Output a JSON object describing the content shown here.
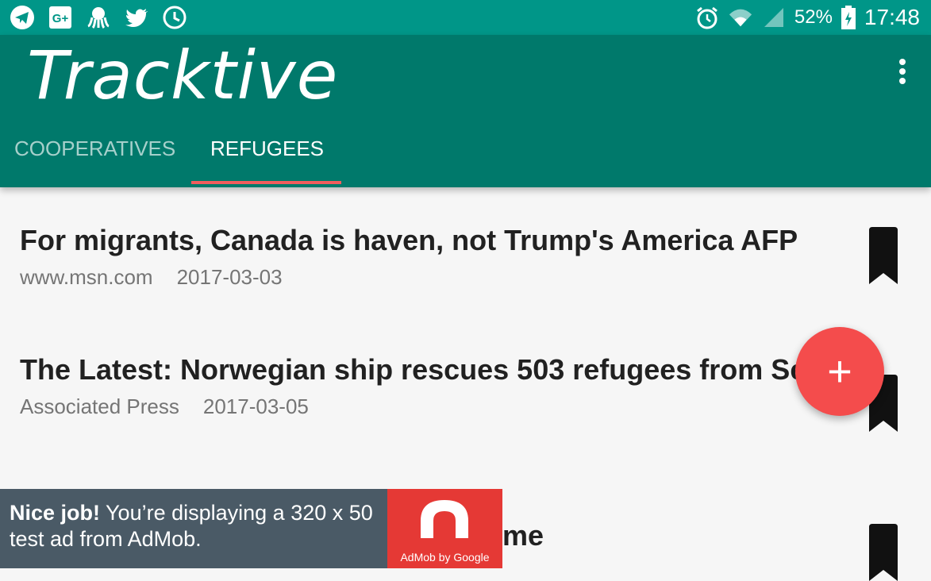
{
  "status_bar": {
    "battery": "52%",
    "time": "17:48",
    "left_icons": [
      "telegram-icon",
      "google-plus-icon",
      "octopus-icon",
      "twitter-icon",
      "clock-icon"
    ],
    "right_icons": [
      "alarm-icon",
      "wifi-icon",
      "signal-icon",
      "battery-icon"
    ]
  },
  "app_bar": {
    "title": "Tracktive",
    "tabs": [
      {
        "label": "COOPERATIVES",
        "active": false
      },
      {
        "label": "REFUGEES",
        "active": true
      }
    ]
  },
  "articles": [
    {
      "title": "For migrants, Canada is haven, not Trump's America AFP",
      "source": "www.msn.com",
      "date": "2017-03-03"
    },
    {
      "title": "The Latest: Norwegian ship rescues 503 refugees from Sea",
      "source": "Associated Press",
      "date": "2017-03-05"
    },
    {
      "title": "me"
    }
  ],
  "fab": {
    "label": "+"
  },
  "ad": {
    "strong": "Nice job!",
    "text": "You’re displaying a 320 x 50 test ad from AdMob.",
    "logo_caption": "AdMob by Google"
  },
  "colors": {
    "status_bar": "#009688",
    "app_bar": "#00796b",
    "tab_indicator": "#f25d5d",
    "fab": "#f44c4c",
    "ad_background": "#4a5a66",
    "ad_logo": "#e53935"
  }
}
